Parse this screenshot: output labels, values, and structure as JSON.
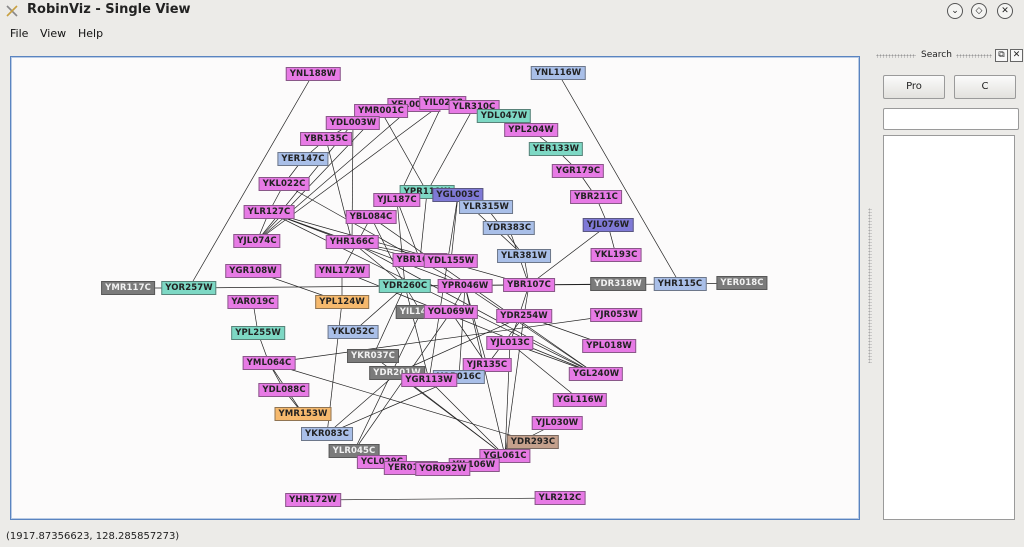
{
  "window": {
    "title": "RobinViz - Single View",
    "controls": [
      {
        "name": "minimize-button",
        "glyph": "⌄"
      },
      {
        "name": "maximize-button",
        "glyph": "◇"
      },
      {
        "name": "close-button",
        "glyph": "✕"
      }
    ]
  },
  "menu": {
    "items": [
      "File",
      "View",
      "Help"
    ]
  },
  "side_panel": {
    "title": "Search",
    "float_glyph": "⧉",
    "close_glyph": "✕",
    "buttons": [
      "Pro",
      "C"
    ],
    "search_value": ""
  },
  "status_bar": {
    "text": "(1917.87356623, 128.285857273)"
  },
  "colors": {
    "pink": "#e77ae5",
    "blue": "#a9bfe8",
    "teal": "#7dd8c4",
    "gray": "#7b7b7b",
    "orange": "#f6b96d",
    "brown": "#c4a08c",
    "indigo": "#7f79d6",
    "canvas_border": "#5a84c0"
  },
  "graph": {
    "nodes": [
      {
        "id": "YNL188W",
        "c": "pink"
      },
      {
        "id": "YNL116W",
        "c": "blue"
      },
      {
        "id": "YFL008W",
        "c": "pink"
      },
      {
        "id": "YIL026C",
        "c": "pink"
      },
      {
        "id": "YMR001C",
        "c": "pink"
      },
      {
        "id": "YLR310C",
        "c": "pink"
      },
      {
        "id": "YDL047W",
        "c": "teal"
      },
      {
        "id": "YDL003W",
        "c": "pink"
      },
      {
        "id": "YPL204W",
        "c": "pink"
      },
      {
        "id": "YBR135C",
        "c": "pink"
      },
      {
        "id": "YER133W",
        "c": "teal"
      },
      {
        "id": "YER147C",
        "c": "blue"
      },
      {
        "id": "YGR179C",
        "c": "pink"
      },
      {
        "id": "YKL022C",
        "c": "pink"
      },
      {
        "id": "YPR119W",
        "c": "teal"
      },
      {
        "id": "YGL003C",
        "c": "indigo"
      },
      {
        "id": "YBR211C",
        "c": "pink"
      },
      {
        "id": "YJL187C",
        "c": "pink"
      },
      {
        "id": "YLR315W",
        "c": "blue"
      },
      {
        "id": "YLR127C",
        "c": "pink"
      },
      {
        "id": "YBL084C",
        "c": "pink"
      },
      {
        "id": "YJL076W",
        "c": "indigo"
      },
      {
        "id": "YDR383C",
        "c": "blue"
      },
      {
        "id": "YJL074C",
        "c": "pink"
      },
      {
        "id": "YHR166C",
        "c": "pink"
      },
      {
        "id": "YKL193C",
        "c": "pink"
      },
      {
        "id": "YLR381W",
        "c": "blue"
      },
      {
        "id": "YBR160W",
        "c": "pink"
      },
      {
        "id": "YDL155W",
        "c": "pink"
      },
      {
        "id": "YGR108W",
        "c": "pink"
      },
      {
        "id": "YNL172W",
        "c": "pink"
      },
      {
        "id": "YMR117C",
        "c": "gray"
      },
      {
        "id": "YOR257W",
        "c": "teal"
      },
      {
        "id": "YDR260C",
        "c": "teal"
      },
      {
        "id": "YPR046W",
        "c": "pink"
      },
      {
        "id": "YBR107C",
        "c": "pink"
      },
      {
        "id": "YDR318W",
        "c": "gray"
      },
      {
        "id": "YHR115C",
        "c": "blue"
      },
      {
        "id": "YER018C",
        "c": "gray"
      },
      {
        "id": "YAR019C",
        "c": "pink"
      },
      {
        "id": "YPL124W",
        "c": "orange"
      },
      {
        "id": "YIL144W",
        "c": "gray"
      },
      {
        "id": "YOL069W",
        "c": "pink"
      },
      {
        "id": "YDR254W",
        "c": "pink"
      },
      {
        "id": "YJR053W",
        "c": "pink"
      },
      {
        "id": "YPL255W",
        "c": "teal"
      },
      {
        "id": "YKL052C",
        "c": "blue"
      },
      {
        "id": "YJL013C",
        "c": "pink"
      },
      {
        "id": "YPL018W",
        "c": "pink"
      },
      {
        "id": "YKR037C",
        "c": "gray"
      },
      {
        "id": "YML064C",
        "c": "pink"
      },
      {
        "id": "YJR135C",
        "c": "pink"
      },
      {
        "id": "YDR201W",
        "c": "gray"
      },
      {
        "id": "YOR016C",
        "c": "blue"
      },
      {
        "id": "YGR113W",
        "c": "pink"
      },
      {
        "id": "YGL240W",
        "c": "pink"
      },
      {
        "id": "YDL088C",
        "c": "pink"
      },
      {
        "id": "YGL116W",
        "c": "pink"
      },
      {
        "id": "YMR153W",
        "c": "orange"
      },
      {
        "id": "YJL030W",
        "c": "pink"
      },
      {
        "id": "YKR083C",
        "c": "blue"
      },
      {
        "id": "YDR293C",
        "c": "brown"
      },
      {
        "id": "YLR045C",
        "c": "gray"
      },
      {
        "id": "YGL061C",
        "c": "pink"
      },
      {
        "id": "YCL029C",
        "c": "pink"
      },
      {
        "id": "YIL106W",
        "c": "pink"
      },
      {
        "id": "YER016W",
        "c": "pink"
      },
      {
        "id": "YOR092W",
        "c": "pink"
      },
      {
        "id": "YHR172W",
        "c": "pink"
      },
      {
        "id": "YLR212C",
        "c": "pink"
      }
    ],
    "edges": [
      [
        "YNL188W",
        "YOR257W"
      ],
      [
        "YNL116W",
        "YHR115C"
      ],
      [
        "YMR117C",
        "YOR257W"
      ],
      [
        "YOR257W",
        "YDR260C"
      ],
      [
        "YDR260C",
        "YBR107C"
      ],
      [
        "YBR107C",
        "YHR115C"
      ],
      [
        "YHR115C",
        "YER018C"
      ],
      [
        "YDR318W",
        "YDR260C"
      ],
      [
        "YHR172W",
        "YLR212C"
      ],
      [
        "YGR108W",
        "YPL124W"
      ],
      [
        "YAR019C",
        "YPL255W"
      ],
      [
        "YPL255W",
        "YML064C"
      ],
      [
        "YML064C",
        "YDL088C"
      ],
      [
        "YDL088C",
        "YMR153W"
      ],
      [
        "YMR153W",
        "YML064C"
      ],
      [
        "YML064C",
        "YDR293C"
      ],
      [
        "YML064C",
        "YJR053W"
      ],
      [
        "YKR083C",
        "YPL124W"
      ],
      [
        "YKR083C",
        "YDR201W"
      ],
      [
        "YKR083C",
        "YOR016C"
      ],
      [
        "YLR045C",
        "YOL069W"
      ],
      [
        "YLR045C",
        "YIL144W"
      ],
      [
        "YCL029C",
        "YIL106W"
      ],
      [
        "YER016W",
        "YOR092W"
      ],
      [
        "YIL106W",
        "YJL030W"
      ],
      [
        "YGL061C",
        "YDR254W"
      ],
      [
        "YGL061C",
        "YPR046W"
      ],
      [
        "YGL061C",
        "YJL013C"
      ],
      [
        "YGL061C",
        "YKR037C"
      ],
      [
        "YGL061C",
        "YGR113W"
      ],
      [
        "YGL061C",
        "YDR201W"
      ],
      [
        "YJR135C",
        "YDR254W"
      ],
      [
        "YJR135C",
        "YPR046W"
      ],
      [
        "YGR113W",
        "YDR260C"
      ],
      [
        "YGR113W",
        "YOR016C"
      ],
      [
        "YGR113W",
        "YGL003C"
      ],
      [
        "YOR016C",
        "YPR046W"
      ],
      [
        "YDR254W",
        "YBR107C"
      ],
      [
        "YDR254W",
        "YPL018W"
      ],
      [
        "YJL013C",
        "YGL240W"
      ],
      [
        "YJL013C",
        "YBR107C"
      ],
      [
        "YGL116W",
        "YJL013C"
      ],
      [
        "YGL240W",
        "YHR166C"
      ],
      [
        "YGL240W",
        "YLR127C"
      ],
      [
        "YGL240W",
        "YPR046W"
      ],
      [
        "YGL240W",
        "YNL172W"
      ],
      [
        "YGL240W",
        "YBL084C"
      ],
      [
        "YBR107C",
        "YJL076W"
      ],
      [
        "YBR107C",
        "YDR383C"
      ],
      [
        "YBR107C",
        "YLR381W"
      ],
      [
        "YLR381W",
        "YLR315W"
      ],
      [
        "YLR381W",
        "YGL003C"
      ],
      [
        "YBR211C",
        "YGR179C"
      ],
      [
        "YBR211C",
        "YJL076W"
      ],
      [
        "YJL076W",
        "YKL193C"
      ],
      [
        "YGR179C",
        "YER133W"
      ],
      [
        "YER133W",
        "YPL204W"
      ],
      [
        "YPL204W",
        "YDL047W"
      ],
      [
        "YDL047W",
        "YLR310C"
      ],
      [
        "YLR310C",
        "YIL026C"
      ],
      [
        "YIL026C",
        "YFL008W"
      ],
      [
        "YFL008W",
        "YMR001C"
      ],
      [
        "YMR001C",
        "YDL003W"
      ],
      [
        "YDL003W",
        "YBR135C"
      ],
      [
        "YBR135C",
        "YER147C"
      ],
      [
        "YER147C",
        "YKL022C"
      ],
      [
        "YKL022C",
        "YLR127C"
      ],
      [
        "YLR127C",
        "YJL074C"
      ],
      [
        "YJL074C",
        "YFL008W"
      ],
      [
        "YJL074C",
        "YIL026C"
      ],
      [
        "YJL074C",
        "YMR001C"
      ],
      [
        "YJL074C",
        "YDL003W"
      ],
      [
        "YKL022C",
        "YPR046W"
      ],
      [
        "YLR127C",
        "YPR046W"
      ],
      [
        "YLR127C",
        "YBR107C"
      ],
      [
        "YHR166C",
        "YBR160W"
      ],
      [
        "YHR166C",
        "YDL155W"
      ],
      [
        "YHR166C",
        "YDR260C"
      ],
      [
        "YNL172W",
        "YBL084C"
      ],
      [
        "YBL084C",
        "YDR260C"
      ],
      [
        "YJL187C",
        "YBR160W"
      ],
      [
        "YJL187C",
        "YIL026C"
      ],
      [
        "YPR119W",
        "YGL003C"
      ],
      [
        "YPR119W",
        "YBR160W"
      ],
      [
        "YGL003C",
        "YDL155W"
      ],
      [
        "YDR260C",
        "YJL187C"
      ],
      [
        "YBR135C",
        "YHR166C"
      ],
      [
        "YDL003W",
        "YHR166C"
      ],
      [
        "YMR001C",
        "YPR119W"
      ],
      [
        "YLR310C",
        "YPR119W"
      ],
      [
        "YLR127C",
        "YHR166C"
      ],
      [
        "YPL124W",
        "YNL172W"
      ],
      [
        "YIL144W",
        "YDR260C"
      ],
      [
        "YOL069W",
        "YPR046W"
      ],
      [
        "YOL069W",
        "YJR135C"
      ],
      [
        "YKL052C",
        "YDR260C"
      ],
      [
        "YKR037C",
        "YDR260C"
      ],
      [
        "YDR201W",
        "YDR254W"
      ]
    ]
  }
}
